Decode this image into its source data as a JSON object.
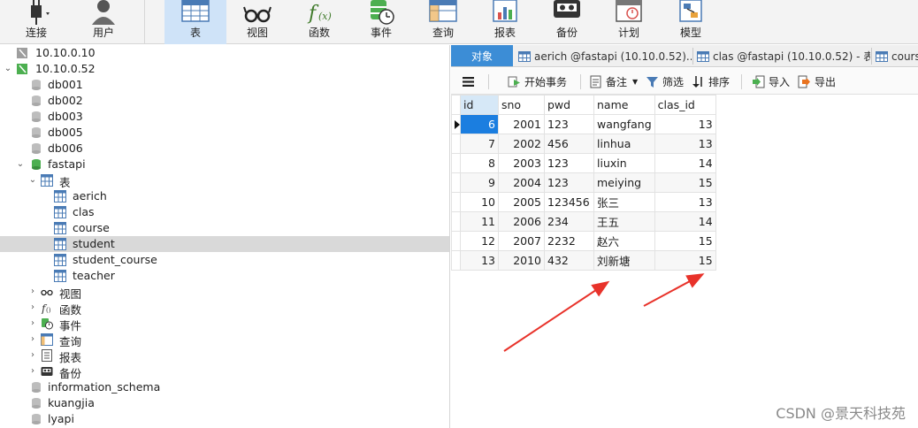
{
  "toolbar": {
    "buttons": [
      {
        "label": "连接",
        "icon": "plug-icon"
      },
      {
        "label": "用户",
        "icon": "user-icon"
      },
      {
        "label": "表",
        "icon": "table-icon"
      },
      {
        "label": "视图",
        "icon": "glasses-icon"
      },
      {
        "label": "函数",
        "icon": "function-icon"
      },
      {
        "label": "事件",
        "icon": "event-clock-icon"
      },
      {
        "label": "查询",
        "icon": "query-icon"
      },
      {
        "label": "报表",
        "icon": "report-chart-icon"
      },
      {
        "label": "备份",
        "icon": "backup-icon"
      },
      {
        "label": "计划",
        "icon": "calendar-icon"
      },
      {
        "label": "模型",
        "icon": "model-icon"
      }
    ]
  },
  "tree": {
    "connections": [
      "10.10.0.10",
      "10.10.0.52"
    ],
    "databases_top": [
      "db001",
      "db002",
      "db003",
      "db005",
      "db006"
    ],
    "fastapi": {
      "name": "fastapi",
      "tables_label": "表",
      "tables": [
        "aerich",
        "clas",
        "course",
        "student",
        "student_course",
        "teacher"
      ],
      "selected_table": "student",
      "groups": [
        {
          "label": "视图",
          "icon": "glasses-icon"
        },
        {
          "label": "函数",
          "icon": "function-icon"
        },
        {
          "label": "事件",
          "icon": "event-clock-icon"
        },
        {
          "label": "查询",
          "icon": "query-icon"
        },
        {
          "label": "报表",
          "icon": "report-icon"
        },
        {
          "label": "备份",
          "icon": "backup-icon"
        }
      ]
    },
    "databases_bottom": [
      "information_schema",
      "kuangjia",
      "lyapi"
    ]
  },
  "tabs": {
    "active": "对象",
    "items": [
      "aerich @fastapi (10.10.0.52)...",
      "clas @fastapi (10.10.0.52) - 表",
      "course"
    ]
  },
  "subbar": {
    "menu_icon": "hamburger-icon",
    "begin_tx": "开始事务",
    "note": "备注",
    "filter": "筛选",
    "sort": "排序",
    "import": "导入",
    "export": "导出"
  },
  "grid": {
    "columns": [
      "id",
      "sno",
      "pwd",
      "name",
      "clas_id"
    ],
    "rows": [
      [
        "6",
        "2001",
        "123",
        "wangfang",
        "13"
      ],
      [
        "7",
        "2002",
        "456",
        "linhua",
        "13"
      ],
      [
        "8",
        "2003",
        "123",
        "liuxin",
        "14"
      ],
      [
        "9",
        "2004",
        "123",
        "meiying",
        "15"
      ],
      [
        "10",
        "2005",
        "123456",
        "张三",
        "13"
      ],
      [
        "11",
        "2006",
        "234",
        "王五",
        "14"
      ],
      [
        "12",
        "2007",
        "2232",
        "赵六",
        "15"
      ],
      [
        "13",
        "2010",
        "432",
        "刘新塘",
        "15"
      ]
    ],
    "selected_row": 0
  },
  "colors": {
    "accent": "#3c8dd6",
    "selected_cell": "#1b7ee0",
    "arrow": "#e8322a"
  },
  "watermark": "CSDN @景天科技苑"
}
